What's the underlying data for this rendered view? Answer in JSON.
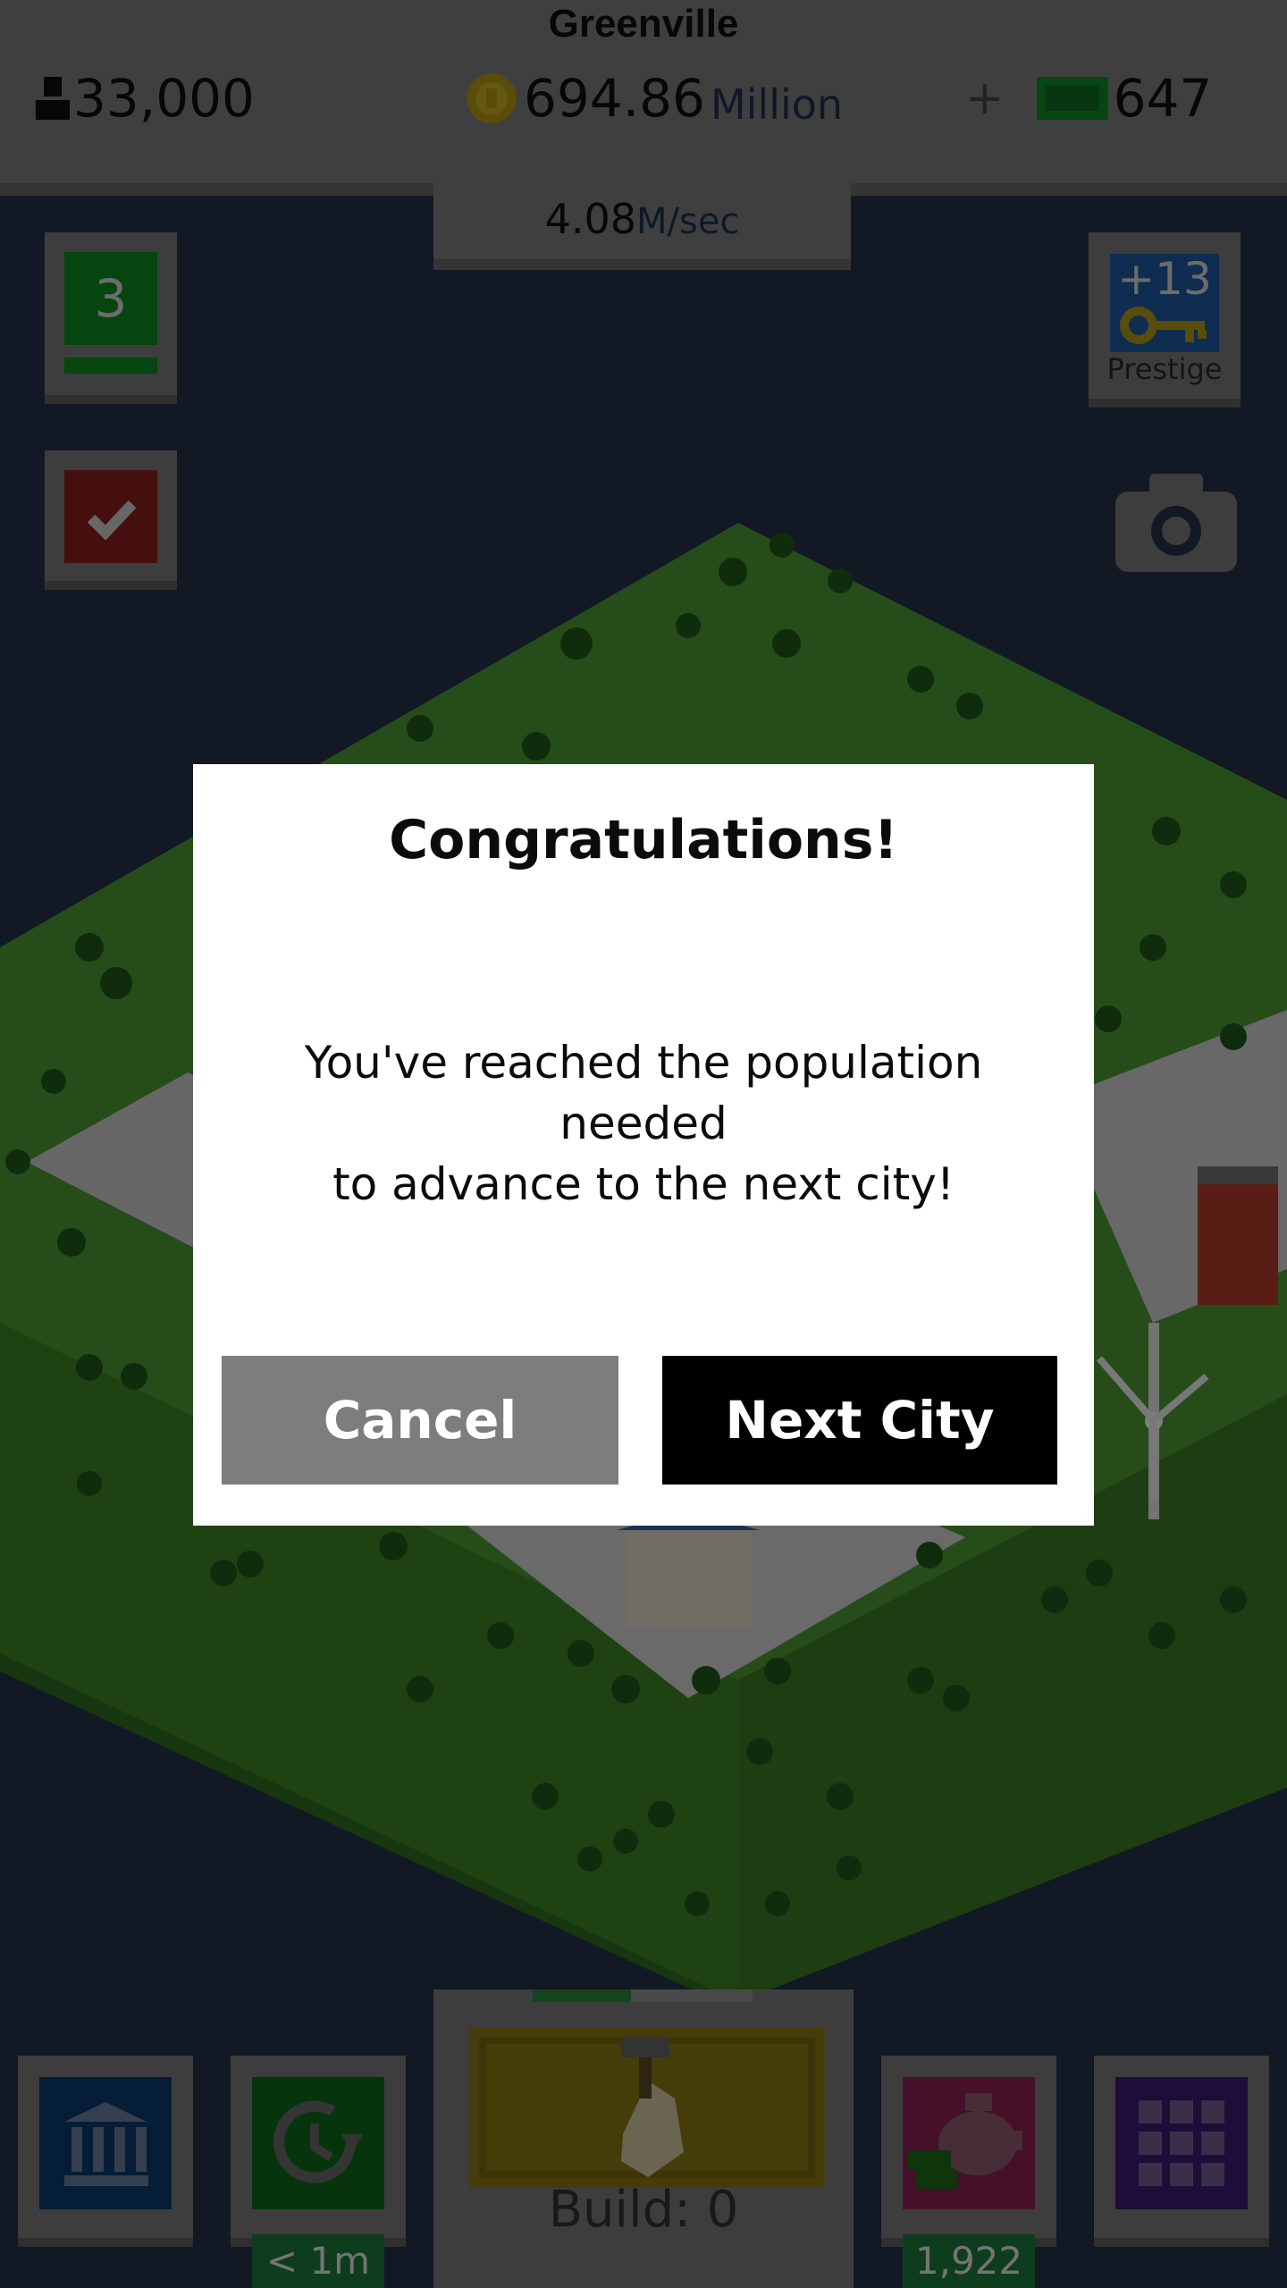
{
  "header": {
    "city_name": "Greenville",
    "population": "33,000",
    "money_amount": "694.86",
    "money_unit": "Million",
    "plus": "+",
    "cash": "647",
    "rate_value": "4.08",
    "rate_unit": "M/sec"
  },
  "left_buttons": {
    "level_value": "3"
  },
  "right_buttons": {
    "prestige_count": "+13",
    "prestige_label": "Prestige"
  },
  "dialog": {
    "title": "Congratulations!",
    "message_line1": "You've reached the population needed",
    "message_line2": "to advance to the next city!",
    "cancel_label": "Cancel",
    "next_label": "Next City"
  },
  "bottom_bar": {
    "build_label": "Build: 0",
    "timer_badge": "< 1m",
    "piggy_badge": "1,922"
  },
  "colors": {
    "dialog_bg": "#ffffff",
    "cancel_bg": "#7d7d7d",
    "next_bg": "#000000",
    "grass": "#3f8a2a",
    "sky": "#26304a"
  }
}
